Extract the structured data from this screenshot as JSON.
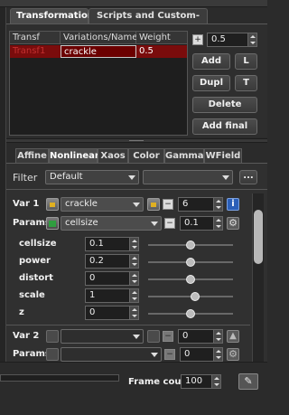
{
  "top_tabs": {
    "transformations": "Transformations",
    "scripts": "Scripts and Custom-Buttons"
  },
  "table": {
    "headers": {
      "transf": "Transf",
      "variations": "Variations/Name",
      "weight": "Weight"
    },
    "row": {
      "transf": "Transf1",
      "variation": "crackle",
      "weight": "0.5"
    }
  },
  "weight_spin": {
    "value": "0.5"
  },
  "buttons": {
    "add": "Add",
    "l": "L",
    "dupl": "Dupl",
    "t": "T",
    "delete": "Delete",
    "add_final": "Add final"
  },
  "sub_tabs": [
    "Affine",
    "Nonlinear",
    "Xaos",
    "Color",
    "Gamma",
    "WField"
  ],
  "filter": {
    "label": "Filter",
    "value": "Default",
    "ellipsis": "..."
  },
  "var1": {
    "label": "Var 1",
    "name": "crackle",
    "value": "6"
  },
  "params1": {
    "label": "Params",
    "name": "cellsize",
    "value": "0.1"
  },
  "params": [
    {
      "name": "cellsize",
      "value": "0.1",
      "level": 0.5
    },
    {
      "name": "power",
      "value": "0.2",
      "level": 0.5
    },
    {
      "name": "distort",
      "value": "0",
      "level": 0.5
    },
    {
      "name": "scale",
      "value": "1",
      "level": 0.55
    },
    {
      "name": "z",
      "value": "0",
      "level": 0.5
    }
  ],
  "var2": {
    "label": "Var 2",
    "name": "",
    "value": "0"
  },
  "params2": {
    "label": "Params",
    "name": "",
    "value": "0"
  },
  "frame_count": {
    "label": "Frame count",
    "value": "100"
  },
  "colors": {
    "selected_row": "#7a0c0c",
    "info_blue": "#2b5fb8"
  }
}
